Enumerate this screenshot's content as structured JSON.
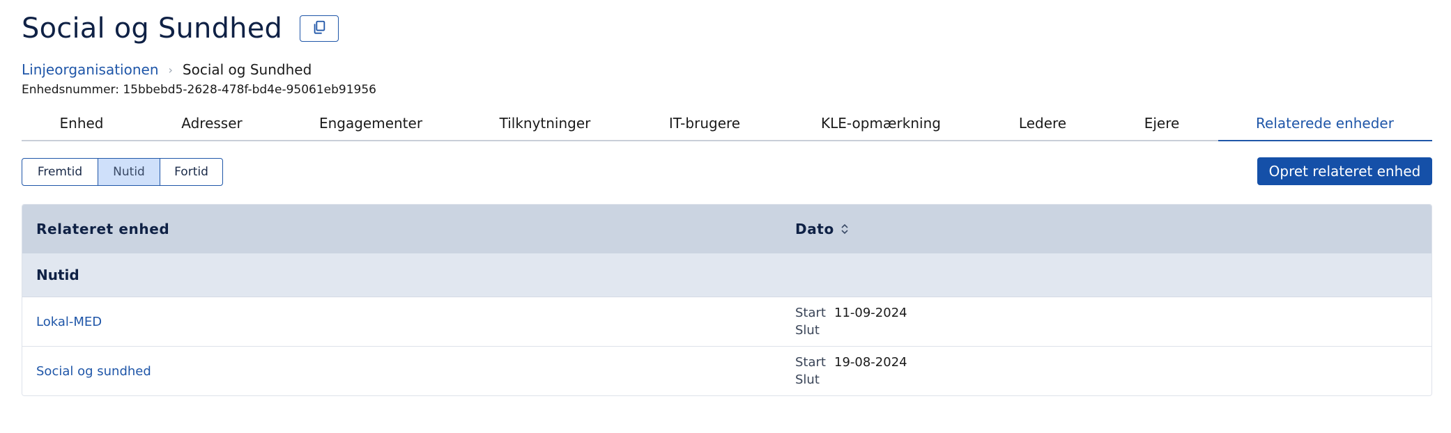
{
  "header": {
    "title": "Social og Sundhed",
    "copy_icon": "copy-icon"
  },
  "breadcrumb": {
    "parent": "Linjeorganisationen",
    "current": "Social og Sundhed"
  },
  "unit_number": "Enhedsnummer: 15bbebd5-2628-478f-bd4e-95061eb91956",
  "tabs": [
    {
      "label": "Enhed"
    },
    {
      "label": "Adresser"
    },
    {
      "label": "Engagementer"
    },
    {
      "label": "Tilknytninger"
    },
    {
      "label": "IT-brugere"
    },
    {
      "label": "KLE-opmærkning"
    },
    {
      "label": "Ledere"
    },
    {
      "label": "Ejere"
    },
    {
      "label": "Relaterede enheder"
    }
  ],
  "active_tab": "Relaterede enheder",
  "time_filter": {
    "options": [
      "Fremtid",
      "Nutid",
      "Fortid"
    ],
    "selected": "Nutid"
  },
  "create_button": "Opret relateret enhed",
  "table": {
    "col_unit": "Relateret enhed",
    "col_date": "Dato",
    "sort_icon": "sort-icon",
    "group": "Nutid",
    "start_label": "Start",
    "end_label": "Slut",
    "rows": [
      {
        "name": "Lokal-MED",
        "start": "11-09-2024",
        "end": ""
      },
      {
        "name": "Social og sundhed",
        "start": "19-08-2024",
        "end": ""
      }
    ]
  },
  "colors": {
    "primary": "#1550a8",
    "link": "#1f56a8",
    "title": "#0f2145",
    "header_bg": "#cbd4e1",
    "group_bg": "#e1e7f0",
    "selected_bg": "#cfe0fa"
  }
}
